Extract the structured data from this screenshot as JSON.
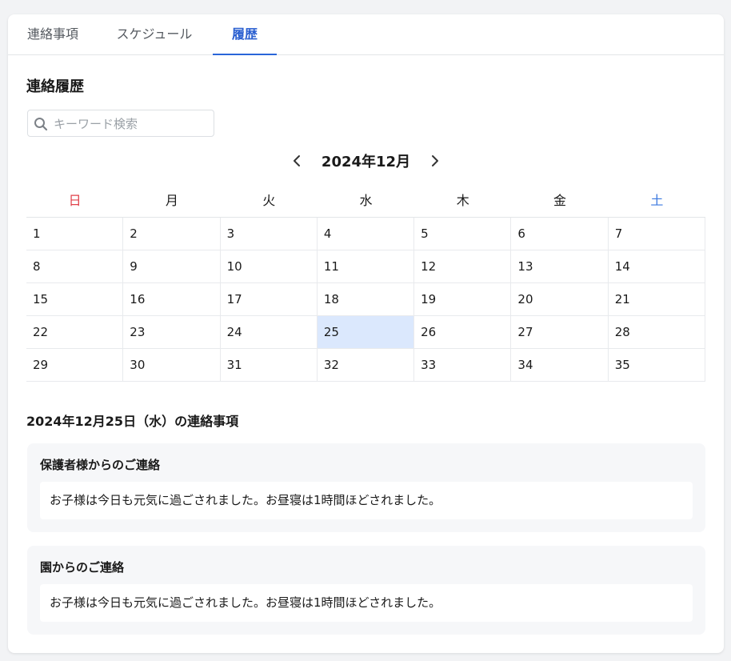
{
  "tabs": [
    {
      "label": "連絡事項"
    },
    {
      "label": "スケジュール"
    },
    {
      "label": "履歴"
    }
  ],
  "section_title": "連絡履歴",
  "search": {
    "placeholder": "キーワード検索",
    "value": ""
  },
  "calendar": {
    "month_label": "2024年12月",
    "weekdays": [
      "日",
      "月",
      "火",
      "水",
      "木",
      "金",
      "土"
    ],
    "weeks": [
      [
        "1",
        "2",
        "3",
        "4",
        "5",
        "6",
        "7"
      ],
      [
        "8",
        "9",
        "10",
        "11",
        "12",
        "13",
        "14"
      ],
      [
        "15",
        "16",
        "17",
        "18",
        "19",
        "20",
        "21"
      ],
      [
        "22",
        "23",
        "24",
        "25",
        "26",
        "27",
        "28"
      ],
      [
        "29",
        "30",
        "31",
        "32",
        "33",
        "34",
        "35"
      ]
    ],
    "selected": "25"
  },
  "day_title": "2024年12月25日（水）の連絡事項",
  "messages": [
    {
      "heading": "保護者様からのご連絡",
      "body": "お子様は今日も元気に過ごされました。お昼寝は1時間ほどされました。"
    },
    {
      "heading": "園からのご連絡",
      "body": "お子様は今日も元気に過ごされました。お昼寝は1時間ほどされました。"
    }
  ],
  "colors": {
    "accent": "#2a66d9",
    "sunday": "#e0424b",
    "saturday": "#3b78e0",
    "selected_day": "#dbe8fd"
  }
}
